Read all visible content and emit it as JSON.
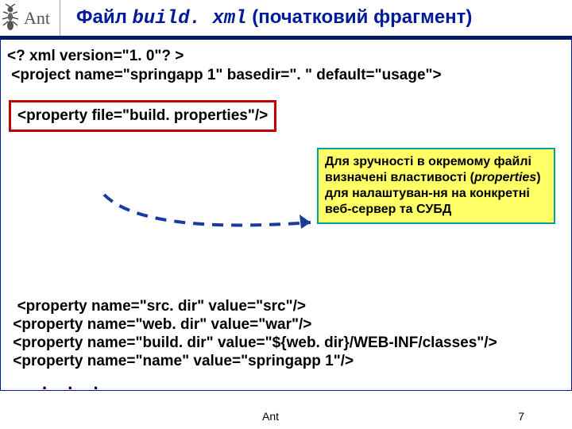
{
  "header": {
    "logo_text": "Ant",
    "title_prefix": "Файл ",
    "title_file": "build. xml",
    "title_suffix": " (початковий фрагмент)"
  },
  "code": {
    "line1": "<? xml version=\"1. 0\"? >",
    "line2": " <project name=\"springapp 1\" basedir=\". \" default=\"usage\">",
    "boxed": "<property file=\"build. properties\"/>",
    "line3": "  <property name=\"src. dir\" value=\"src\"/>",
    "line4": " <property name=\"web. dir\" value=\"war\"/>",
    "line5": " <property name=\"build. dir\" value=\"${web. dir}/WEB-INF/classes\"/>",
    "line6": " <property name=\"name\" value=\"springapp 1\"/>",
    "dots": ". . ."
  },
  "callout": {
    "l1": "Для зручності в окремому файлі визначені властивості (",
    "l2": "properties",
    "l3": ") для налаштуван-ня на конкретні веб-сервер та СУБД"
  },
  "footer": {
    "label": "Ant",
    "page": "7"
  }
}
